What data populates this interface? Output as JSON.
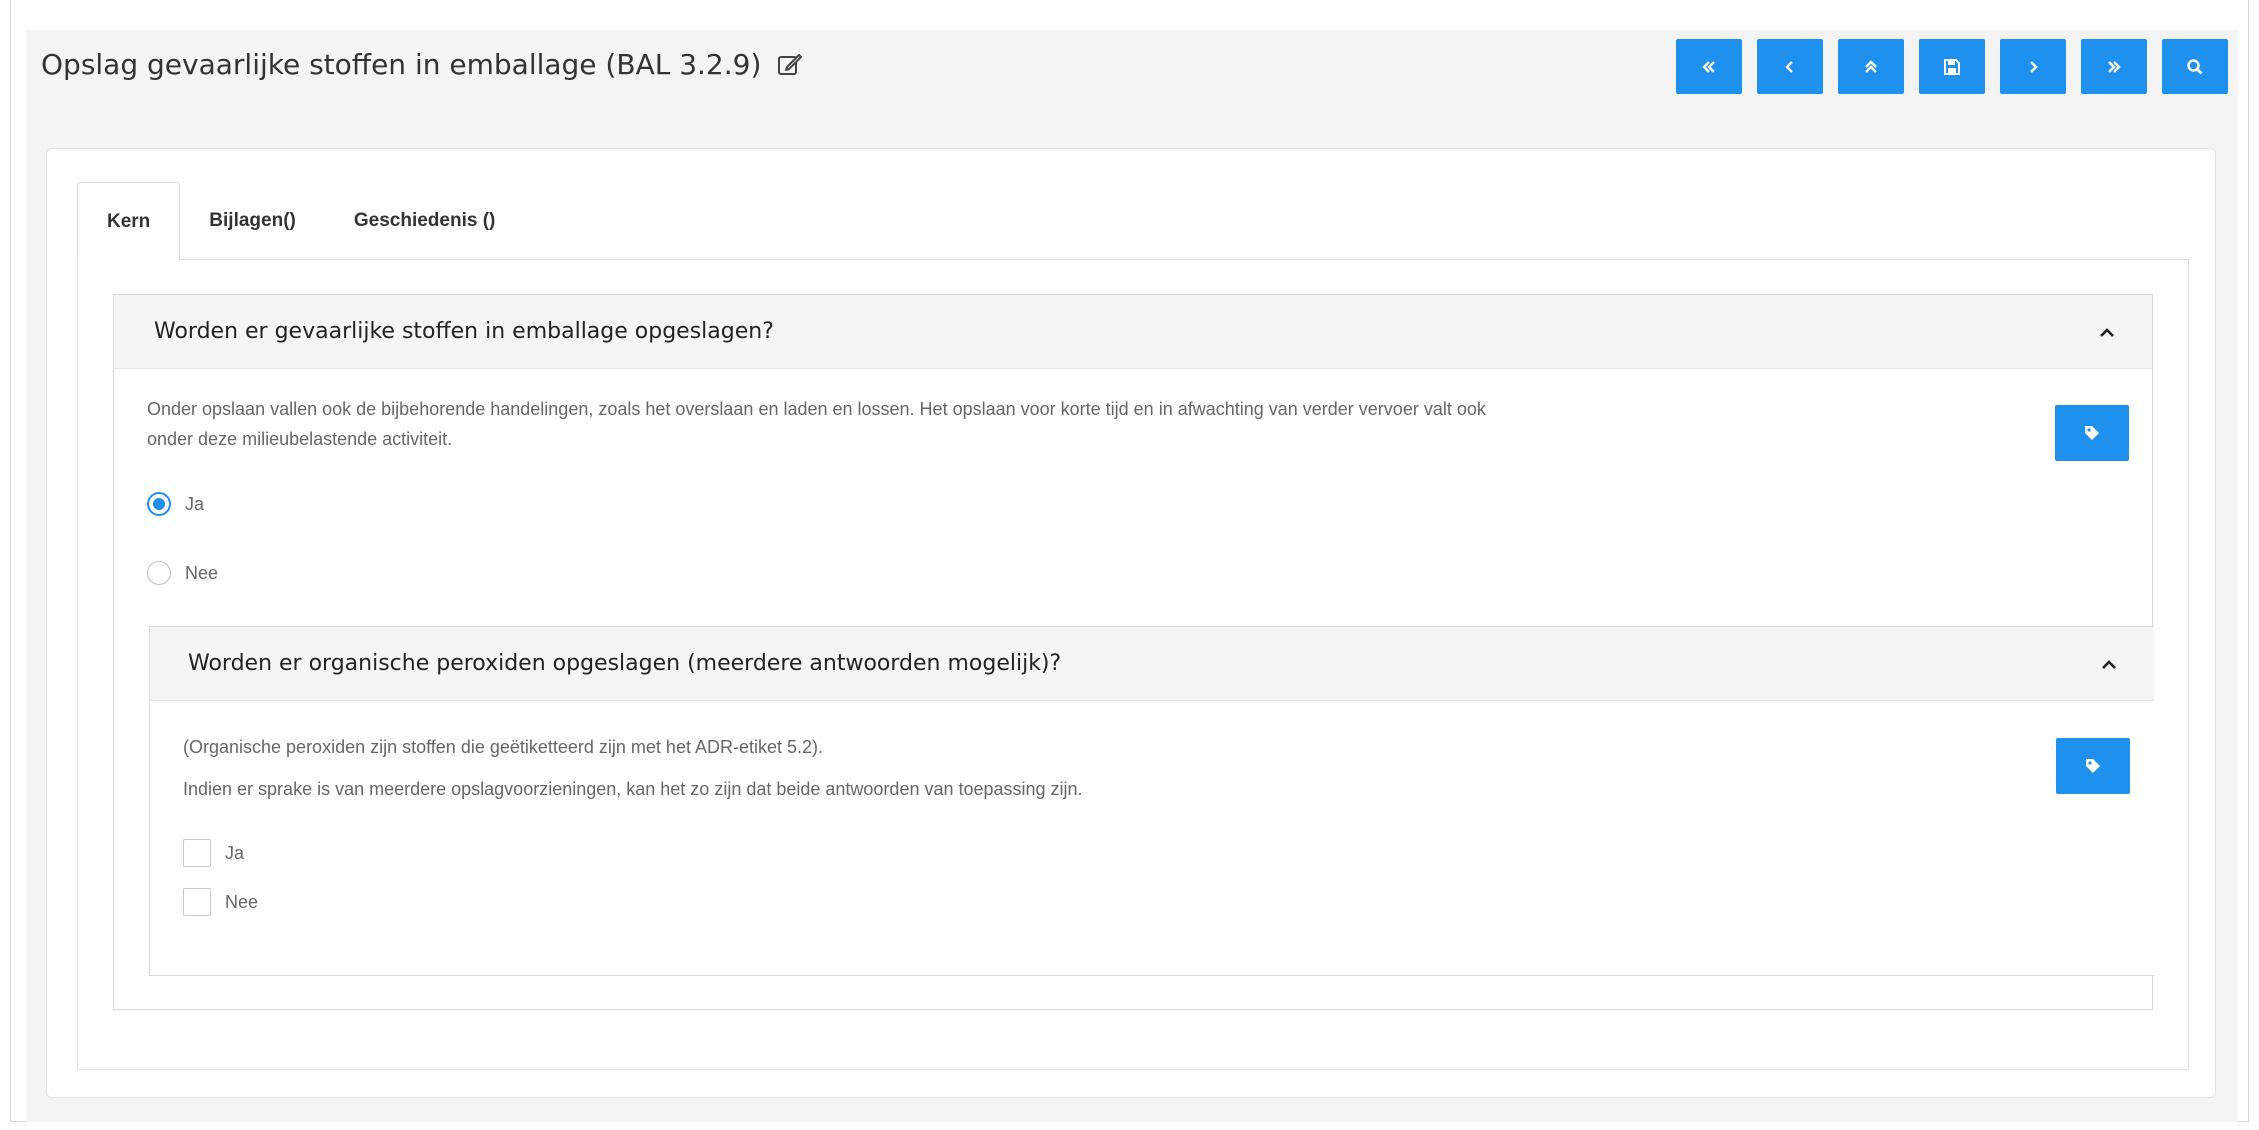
{
  "page": {
    "title": "Opslag gevaarlijke stoffen in emballage (BAL 3.2.9)",
    "edit_icon": "edit-icon"
  },
  "toolbar": {
    "buttons": [
      {
        "name": "first",
        "icon": "double-chevron-left-icon"
      },
      {
        "name": "previous",
        "icon": "chevron-left-icon"
      },
      {
        "name": "up",
        "icon": "double-chevron-up-icon"
      },
      {
        "name": "save",
        "icon": "save-icon"
      },
      {
        "name": "next",
        "icon": "chevron-right-icon"
      },
      {
        "name": "last",
        "icon": "double-chevron-right-icon"
      },
      {
        "name": "search",
        "icon": "search-icon"
      }
    ],
    "accent_color": "#1e90ee"
  },
  "tabs": [
    {
      "label": "Kern",
      "active": true
    },
    {
      "label": "Bijlagen()",
      "active": false
    },
    {
      "label": "Geschiedenis ()",
      "active": false
    }
  ],
  "question1": {
    "title": "Worden er gevaarlijke stoffen in emballage opgeslagen?",
    "description_line1": "Onder opslaan vallen ook de bijbehorende handelingen, zoals het overslaan en laden en lossen. Het opslaan voor korte tijd en in afwachting van verder vervoer valt ook",
    "description_line2": "onder deze milieubelastende activiteit.",
    "options": [
      {
        "label": "Ja",
        "selected": true
      },
      {
        "label": "Nee",
        "selected": false
      }
    ]
  },
  "question2": {
    "title": "Worden er organische peroxiden opgeslagen (meerdere antwoorden mogelijk)?",
    "description_line1": "(Organische peroxiden zijn stoffen die geëtiketteerd zijn met het ADR-etiket 5.2).",
    "description_line2": "Indien er sprake is van meerdere opslagvoorzieningen, kan het zo zijn dat beide antwoorden van toepassing zijn.",
    "options": [
      {
        "label": "Ja",
        "checked": false
      },
      {
        "label": "Nee",
        "checked": false
      }
    ]
  }
}
